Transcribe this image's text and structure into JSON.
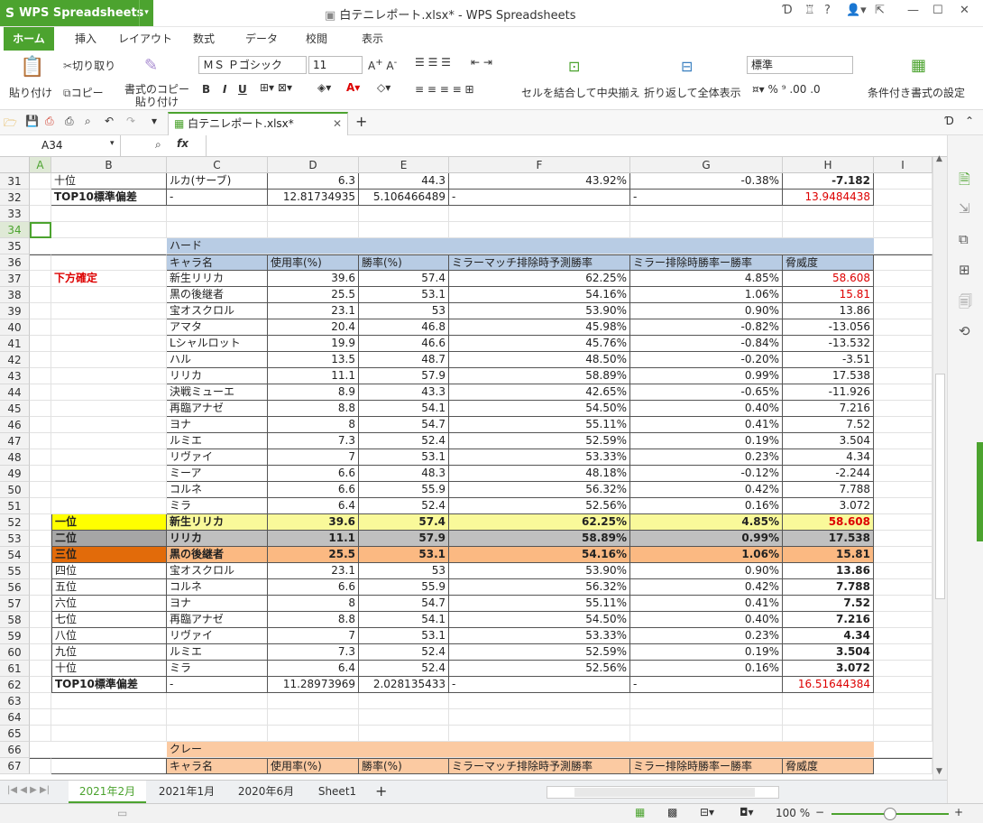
{
  "app": {
    "name": "WPS Spreadsheets",
    "title": "白テニレポート.xlsx* - WPS Spreadsheets"
  },
  "menu": [
    "ホーム",
    "挿入",
    "レイアウト",
    "数式",
    "データ",
    "校閲",
    "表示"
  ],
  "ribbon": {
    "paste": "貼り付け",
    "cut": "切り取り",
    "copy": "コピー",
    "format_painter": "書式のコピー\n貼り付け",
    "font": "ＭＳ Ｐゴシック",
    "size": "11",
    "merge": "セルを結合して中央揃え",
    "wrap": "折り返して全体表示",
    "numfmt": "標準",
    "cond": "条件付き書式の設定"
  },
  "doc_tab": "白テニレポート.xlsx*",
  "namebox": "A34",
  "columns": [
    "A",
    "B",
    "C",
    "D",
    "E",
    "F",
    "G",
    "H",
    "I"
  ],
  "sheet_tabs": [
    "2021年2月",
    "2021年1月",
    "2020年6月",
    "Sheet1"
  ],
  "zoom": "100 %",
  "rows": [
    {
      "n": "31",
      "c": [
        "",
        "十位",
        "ルカ(サーブ)",
        "6.3",
        "44.3",
        "43.92%",
        "-0.38%",
        "-7.182",
        ""
      ]
    },
    {
      "n": "32",
      "c": [
        "",
        "TOP10標準偏差",
        "-",
        "12.81734935",
        "5.106466489",
        "-",
        "-",
        "13.9484438",
        ""
      ]
    },
    {
      "n": "33",
      "c": [
        "",
        "",
        "",
        "",
        "",
        "",
        "",
        "",
        ""
      ]
    },
    {
      "n": "34",
      "c": [
        "",
        "",
        "",
        "",
        "",
        "",
        "",
        "",
        ""
      ]
    },
    {
      "n": "35",
      "c": [
        "",
        "",
        "ハード",
        "",
        "",
        "",
        "",
        "",
        ""
      ]
    },
    {
      "n": "36",
      "c": [
        "",
        "",
        "キャラ名",
        "使用率(%)",
        "勝率(%)",
        "ミラーマッチ排除時予測勝率",
        "ミラー排除時勝率ー勝率",
        "脅威度",
        ""
      ]
    },
    {
      "n": "37",
      "c": [
        "",
        "下方確定",
        "新生リリカ",
        "39.6",
        "57.4",
        "62.25%",
        "4.85%",
        "58.608",
        ""
      ]
    },
    {
      "n": "38",
      "c": [
        "",
        "",
        "黒の後継者",
        "25.5",
        "53.1",
        "54.16%",
        "1.06%",
        "15.81",
        ""
      ]
    },
    {
      "n": "39",
      "c": [
        "",
        "",
        "宝オスクロル",
        "23.1",
        "53",
        "53.90%",
        "0.90%",
        "13.86",
        ""
      ]
    },
    {
      "n": "40",
      "c": [
        "",
        "",
        "アマタ",
        "20.4",
        "46.8",
        "45.98%",
        "-0.82%",
        "-13.056",
        ""
      ]
    },
    {
      "n": "41",
      "c": [
        "",
        "",
        "Lシャルロット",
        "19.9",
        "46.6",
        "45.76%",
        "-0.84%",
        "-13.532",
        ""
      ]
    },
    {
      "n": "42",
      "c": [
        "",
        "",
        "ハル",
        "13.5",
        "48.7",
        "48.50%",
        "-0.20%",
        "-3.51",
        ""
      ]
    },
    {
      "n": "43",
      "c": [
        "",
        "",
        "リリカ",
        "11.1",
        "57.9",
        "58.89%",
        "0.99%",
        "17.538",
        ""
      ]
    },
    {
      "n": "44",
      "c": [
        "",
        "",
        "決戦ミューエ",
        "8.9",
        "43.3",
        "42.65%",
        "-0.65%",
        "-11.926",
        ""
      ]
    },
    {
      "n": "45",
      "c": [
        "",
        "",
        "再臨アナゼ",
        "8.8",
        "54.1",
        "54.50%",
        "0.40%",
        "7.216",
        ""
      ]
    },
    {
      "n": "46",
      "c": [
        "",
        "",
        "ヨナ",
        "8",
        "54.7",
        "55.11%",
        "0.41%",
        "7.52",
        ""
      ]
    },
    {
      "n": "47",
      "c": [
        "",
        "",
        "ルミエ",
        "7.3",
        "52.4",
        "52.59%",
        "0.19%",
        "3.504",
        ""
      ]
    },
    {
      "n": "48",
      "c": [
        "",
        "",
        "リヴァイ",
        "7",
        "53.1",
        "53.33%",
        "0.23%",
        "4.34",
        ""
      ]
    },
    {
      "n": "49",
      "c": [
        "",
        "",
        "ミーア",
        "6.6",
        "48.3",
        "48.18%",
        "-0.12%",
        "-2.244",
        ""
      ]
    },
    {
      "n": "50",
      "c": [
        "",
        "",
        "コルネ",
        "6.6",
        "55.9",
        "56.32%",
        "0.42%",
        "7.788",
        ""
      ]
    },
    {
      "n": "51",
      "c": [
        "",
        "",
        "ミラ",
        "6.4",
        "52.4",
        "52.56%",
        "0.16%",
        "3.072",
        ""
      ]
    },
    {
      "n": "52",
      "c": [
        "",
        "一位",
        "新生リリカ",
        "39.6",
        "57.4",
        "62.25%",
        "4.85%",
        "58.608",
        ""
      ]
    },
    {
      "n": "53",
      "c": [
        "",
        "二位",
        "リリカ",
        "11.1",
        "57.9",
        "58.89%",
        "0.99%",
        "17.538",
        ""
      ]
    },
    {
      "n": "54",
      "c": [
        "",
        "三位",
        "黒の後継者",
        "25.5",
        "53.1",
        "54.16%",
        "1.06%",
        "15.81",
        ""
      ]
    },
    {
      "n": "55",
      "c": [
        "",
        "四位",
        "宝オスクロル",
        "23.1",
        "53",
        "53.90%",
        "0.90%",
        "13.86",
        ""
      ]
    },
    {
      "n": "56",
      "c": [
        "",
        "五位",
        "コルネ",
        "6.6",
        "55.9",
        "56.32%",
        "0.42%",
        "7.788",
        ""
      ]
    },
    {
      "n": "57",
      "c": [
        "",
        "六位",
        "ヨナ",
        "8",
        "54.7",
        "55.11%",
        "0.41%",
        "7.52",
        ""
      ]
    },
    {
      "n": "58",
      "c": [
        "",
        "七位",
        "再臨アナゼ",
        "8.8",
        "54.1",
        "54.50%",
        "0.40%",
        "7.216",
        ""
      ]
    },
    {
      "n": "59",
      "c": [
        "",
        "八位",
        "リヴァイ",
        "7",
        "53.1",
        "53.33%",
        "0.23%",
        "4.34",
        ""
      ]
    },
    {
      "n": "60",
      "c": [
        "",
        "九位",
        "ルミエ",
        "7.3",
        "52.4",
        "52.59%",
        "0.19%",
        "3.504",
        ""
      ]
    },
    {
      "n": "61",
      "c": [
        "",
        "十位",
        "ミラ",
        "6.4",
        "52.4",
        "52.56%",
        "0.16%",
        "3.072",
        ""
      ]
    },
    {
      "n": "62",
      "c": [
        "",
        "TOP10標準偏差",
        "-",
        "11.28973969",
        "2.028135433",
        "-",
        "-",
        "16.51644384",
        ""
      ]
    },
    {
      "n": "63",
      "c": [
        "",
        "",
        "",
        "",
        "",
        "",
        "",
        "",
        ""
      ]
    },
    {
      "n": "64",
      "c": [
        "",
        "",
        "",
        "",
        "",
        "",
        "",
        "",
        ""
      ]
    },
    {
      "n": "65",
      "c": [
        "",
        "",
        "",
        "",
        "",
        "",
        "",
        "",
        ""
      ]
    },
    {
      "n": "66",
      "c": [
        "",
        "",
        "クレー",
        "",
        "",
        "",
        "",
        "",
        ""
      ]
    },
    {
      "n": "67",
      "c": [
        "",
        "",
        "キャラ名",
        "使用率(%)",
        "勝率(%)",
        "ミラーマッチ排除時予測勝率",
        "ミラー排除時勝率ー勝率",
        "脅威度",
        ""
      ]
    }
  ],
  "colors": {
    "accent": "#4ca32f",
    "hard_header": "#b8cce4",
    "clay_header": "#fbcaa2",
    "first": "#ffff00",
    "first_row": "#f9f99a",
    "second": "#a6a6a6",
    "second_row": "#c0c0c0",
    "third": "#e26b0a",
    "third_row": "#fbb982"
  }
}
